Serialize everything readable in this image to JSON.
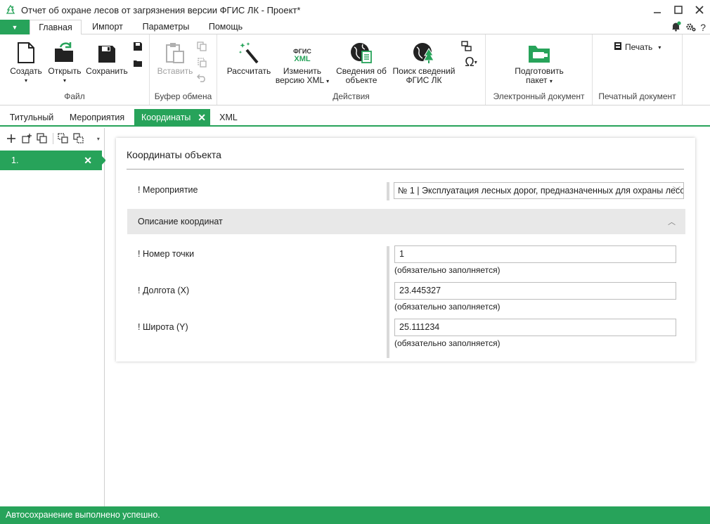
{
  "window": {
    "title": "Отчет об охране лесов от загрязнения версии ФГИС ЛК - Проект*"
  },
  "menu": {
    "dropdown_glyph": "▼",
    "tabs": [
      {
        "label": "Главная"
      },
      {
        "label": "Импорт"
      },
      {
        "label": "Параметры"
      },
      {
        "label": "Помощь"
      }
    ]
  },
  "ribbon": {
    "file": {
      "create": "Создать",
      "open": "Открыть",
      "save": "Сохранить",
      "group": "Файл"
    },
    "clipboard": {
      "paste": "Вставить",
      "group": "Буфер обмена"
    },
    "actions": {
      "calculate": "Рассчитать",
      "fgis_icon_top": "ФГИС",
      "fgis_icon_bottom": "XML",
      "change_xml_1": "Изменить",
      "change_xml_2": "версию XML",
      "object_info_1": "Сведения об",
      "object_info_2": "объекте",
      "search_1": "Поиск сведений",
      "search_2": "ФГИС ЛК",
      "group": "Действия"
    },
    "edoc": {
      "prepare_1": "Подготовить",
      "prepare_2": "пакет",
      "group": "Электронный документ"
    },
    "print": {
      "print": "Печать",
      "group": "Печатный документ"
    }
  },
  "doc_tabs": [
    {
      "label": "Титульный"
    },
    {
      "label": "Мероприятия"
    },
    {
      "label": "Координаты"
    },
    {
      "label": "XML"
    }
  ],
  "left_panel": {
    "items": [
      {
        "label": "1."
      }
    ]
  },
  "form": {
    "title": "Координаты объекта",
    "event_label": "! Мероприятие",
    "event_value": "№ 1 | Эксплуатация лесных дорог, предназначенных для охраны лесо",
    "section_title": "Описание координат",
    "fields": [
      {
        "label": "! Номер точки",
        "value": "1",
        "hint": "(обязательно заполняется)"
      },
      {
        "label": "! Долгота (X)",
        "value": "23.445327",
        "hint": "(обязательно заполняется)"
      },
      {
        "label": "! Широта (Y)",
        "value": "25.111234",
        "hint": "(обязательно заполняется)"
      }
    ]
  },
  "status": {
    "text": "Автосохранение выполнено успешно."
  },
  "colors": {
    "accent": "#27a35a"
  }
}
